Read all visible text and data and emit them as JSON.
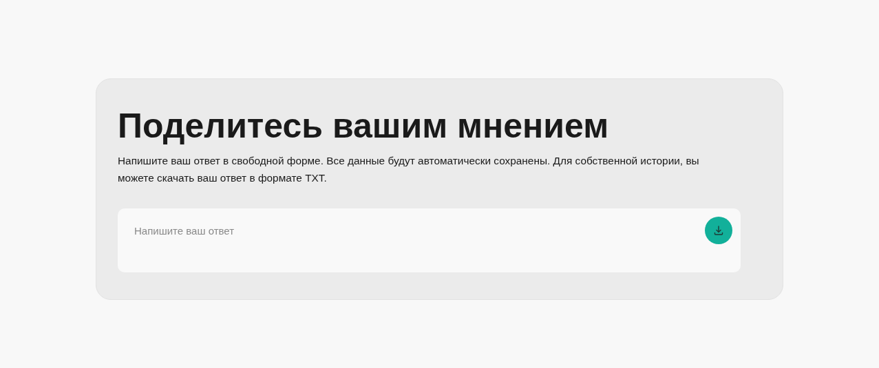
{
  "title": "Поделитесь вашим мнением",
  "description": "Напишите ваш ответ в свободной форме. Все данные будут автоматически сохранены. Для собственной истории, вы можете скачать ваш ответ в формате TXT.",
  "answer": {
    "placeholder": "Напишите ваш ответ"
  }
}
